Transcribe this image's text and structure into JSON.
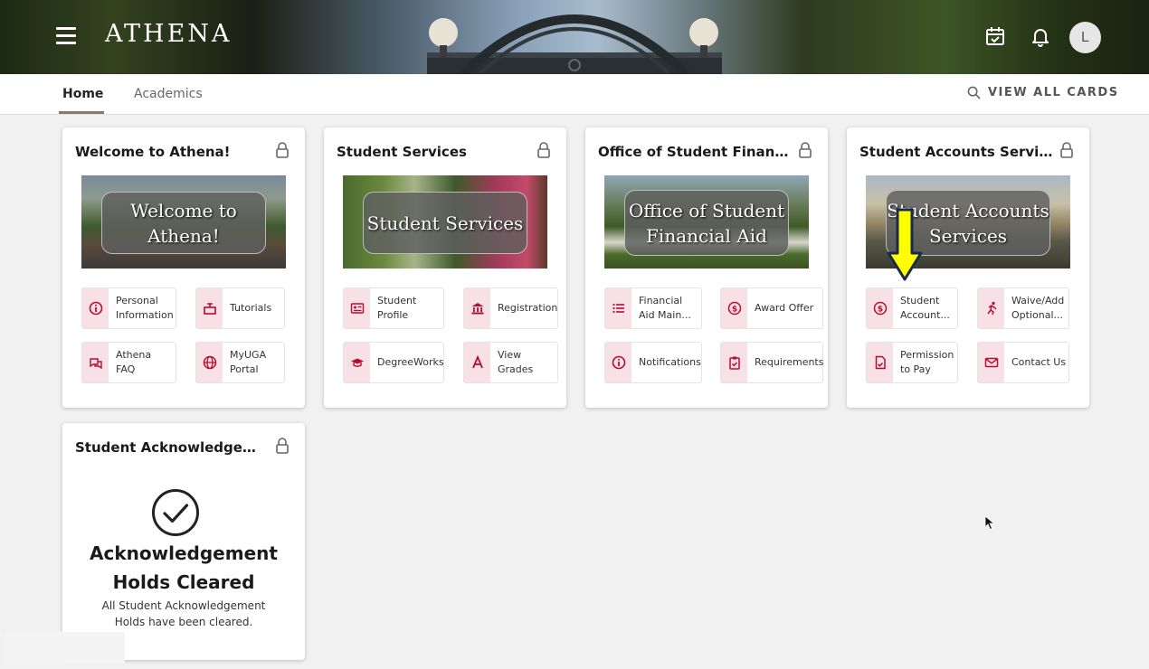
{
  "app": {
    "brand": "ATHENA",
    "avatar_initial": "L"
  },
  "icons": {
    "menu": "menu-icon",
    "calendar": "calendar-check-icon",
    "bell": "bell-icon",
    "search": "search-icon",
    "lock": "lock-icon"
  },
  "colors": {
    "accent": "#ba0c2f",
    "icon_bg": "#f8e1e6",
    "tab_underline": "#8a7766",
    "arrow": "#ffff00"
  },
  "tabs": [
    {
      "label": "Home",
      "active": true
    },
    {
      "label": "Academics",
      "active": false
    }
  ],
  "view_all": "VIEW ALL CARDS",
  "cards": [
    {
      "title": "Welcome to Athena!",
      "image_label": "Welcome to Athena!",
      "links": [
        {
          "label": "Personal\nInformation",
          "icon": "info-icon"
        },
        {
          "label": "Tutorials",
          "icon": "tutorial-icon"
        },
        {
          "label": "Athena\nFAQ",
          "icon": "chat-icon"
        },
        {
          "label": "MyUGA\nPortal",
          "icon": "globe-icon"
        }
      ]
    },
    {
      "title": "Student Services",
      "image_label": "Student Services",
      "links": [
        {
          "label": "Student\nProfile",
          "icon": "id-card-icon"
        },
        {
          "label": "Registration",
          "icon": "bank-icon"
        },
        {
          "label": "DegreeWorks",
          "icon": "graduation-cap-icon"
        },
        {
          "label": "View\nGrades",
          "icon": "letter-a-icon"
        }
      ]
    },
    {
      "title": "Office of Student Financi...",
      "image_label": "Office of Student\nFinancial Aid",
      "links": [
        {
          "label": "Financial\nAid Main...",
          "icon": "list-icon"
        },
        {
          "label": "Award Offer",
          "icon": "dollar-icon"
        },
        {
          "label": "Notifications",
          "icon": "info-icon"
        },
        {
          "label": "Requirements",
          "icon": "clipboard-check-icon"
        }
      ]
    },
    {
      "title": "Student Accounts Services",
      "image_label": "Student Accounts\nServices",
      "links": [
        {
          "label": "Student\nAccount...",
          "icon": "dollar-icon"
        },
        {
          "label": "Waive/Add\nOptional...",
          "icon": "running-person-icon"
        },
        {
          "label": "Permission\nto Pay",
          "icon": "document-icon"
        },
        {
          "label": "Contact Us",
          "icon": "mail-icon"
        }
      ]
    },
    {
      "title": "Student Acknowledgeme...",
      "heading_line1": "Acknowledgement",
      "heading_line2": "Holds Cleared",
      "text_line1": "All Student Acknowledgement",
      "text_line2": "Holds have been cleared.",
      "icon": "check-circle-icon"
    }
  ]
}
